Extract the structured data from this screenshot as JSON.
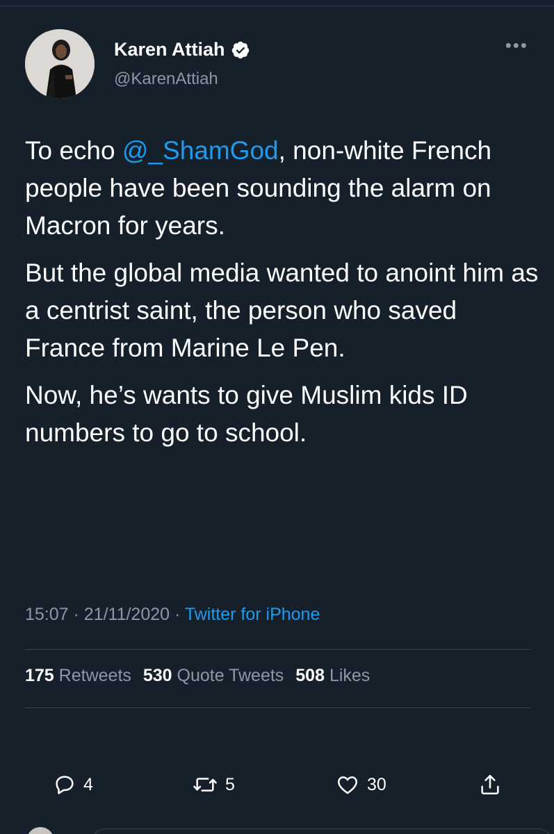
{
  "author": {
    "name": "Karen Attiah",
    "handle": "@KarenAttiah"
  },
  "tweet": {
    "p1_pre": "To echo ",
    "p1_mention": "@_ShamGod",
    "p1_post": ", non-white French people have been sounding the alarm on Macron for years.",
    "p2": "But the global media wanted to anoint him as a centrist saint, the person who saved France from Marine Le Pen.",
    "p3": "Now, he’s wants to give Muslim kids ID numbers to go to school."
  },
  "meta": {
    "time": "15:07",
    "sep1": " · ",
    "date": "21/11/2020",
    "sep2": " · ",
    "source": "Twitter for iPhone"
  },
  "stats": {
    "retweets_count": "175",
    "retweets_label": "Retweets",
    "quotes_count": "530",
    "quotes_label": "Quote Tweets",
    "likes_count": "508",
    "likes_label": "Likes"
  },
  "actions": {
    "reply_count": "4",
    "retweet_count": "5",
    "like_count": "30"
  },
  "colors": {
    "background": "#15202b",
    "accent": "#1d9bf0",
    "secondary_text": "#8b98a5",
    "divider": "#38444d"
  },
  "icons": [
    "verified-badge-icon",
    "more-options-icon",
    "reply-icon",
    "retweet-icon",
    "like-icon",
    "share-icon"
  ]
}
